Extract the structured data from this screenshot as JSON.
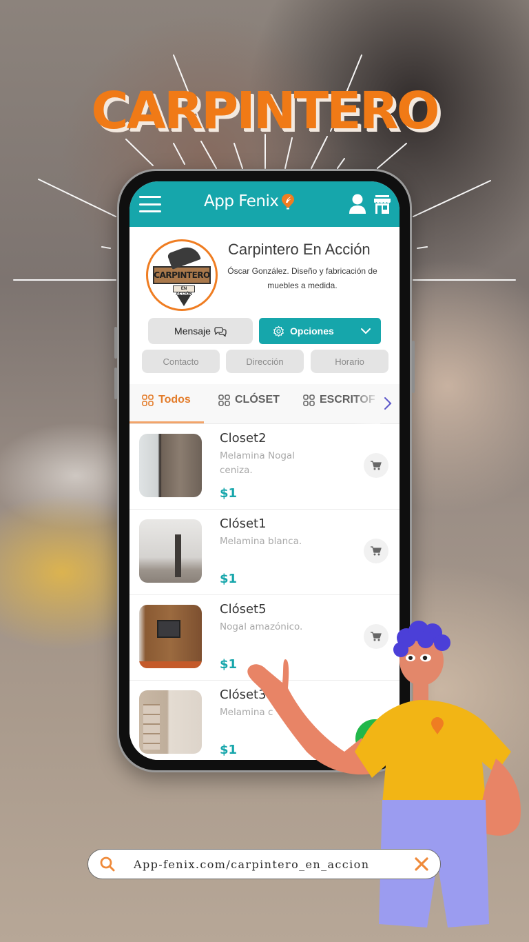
{
  "headline": "CARPINTERO",
  "app": {
    "brand_name": "App Fenix",
    "menu_icon": "hamburger-menu-icon",
    "user_icon": "user-icon",
    "store_icon": "storefront-icon",
    "brand_icon": "fenix-pin-logo-icon"
  },
  "profile": {
    "logo_text": "CARPINTERO",
    "logo_subtext": "EN ACCIÓN",
    "business_name": "Carpintero En Acción",
    "description": "Óscar González. Diseño y fabricación de muebles a medida."
  },
  "actions": {
    "message_label": "Mensaje",
    "message_icon": "chat-bubbles-icon",
    "options_label": "Opciones",
    "options_icon": "gear-icon",
    "options_chevron": "chevron-down-icon"
  },
  "info_pills": [
    {
      "label": "Contacto"
    },
    {
      "label": "Dirección"
    },
    {
      "label": "Horario"
    }
  ],
  "tabs": [
    {
      "label": "Todos",
      "icon": "grid-icon",
      "active": true
    },
    {
      "label": "CLÓSET",
      "icon": "grid-icon",
      "active": false
    },
    {
      "label": "ESCRITOF",
      "icon": "grid-icon",
      "active": false
    }
  ],
  "products": [
    {
      "title": "Closet2",
      "description": "Melamina Nogal ceniza.",
      "price": "$1"
    },
    {
      "title": "Clóset1",
      "description": "Melamina blanca.",
      "price": "$1"
    },
    {
      "title": "Clóset5",
      "description": "Nogal amazónico.",
      "price": "$1"
    },
    {
      "title": "Clóset3",
      "description": "Melamina c",
      "price": "$1"
    }
  ],
  "url_bar": {
    "url": "App-fenix.com/carpintero_en_accion",
    "search_icon": "search-icon",
    "clear_icon": "close-icon"
  },
  "colors": {
    "primary_teal": "#16a6ab",
    "accent_orange": "#f07a16",
    "whatsapp_green": "#22b74a"
  }
}
